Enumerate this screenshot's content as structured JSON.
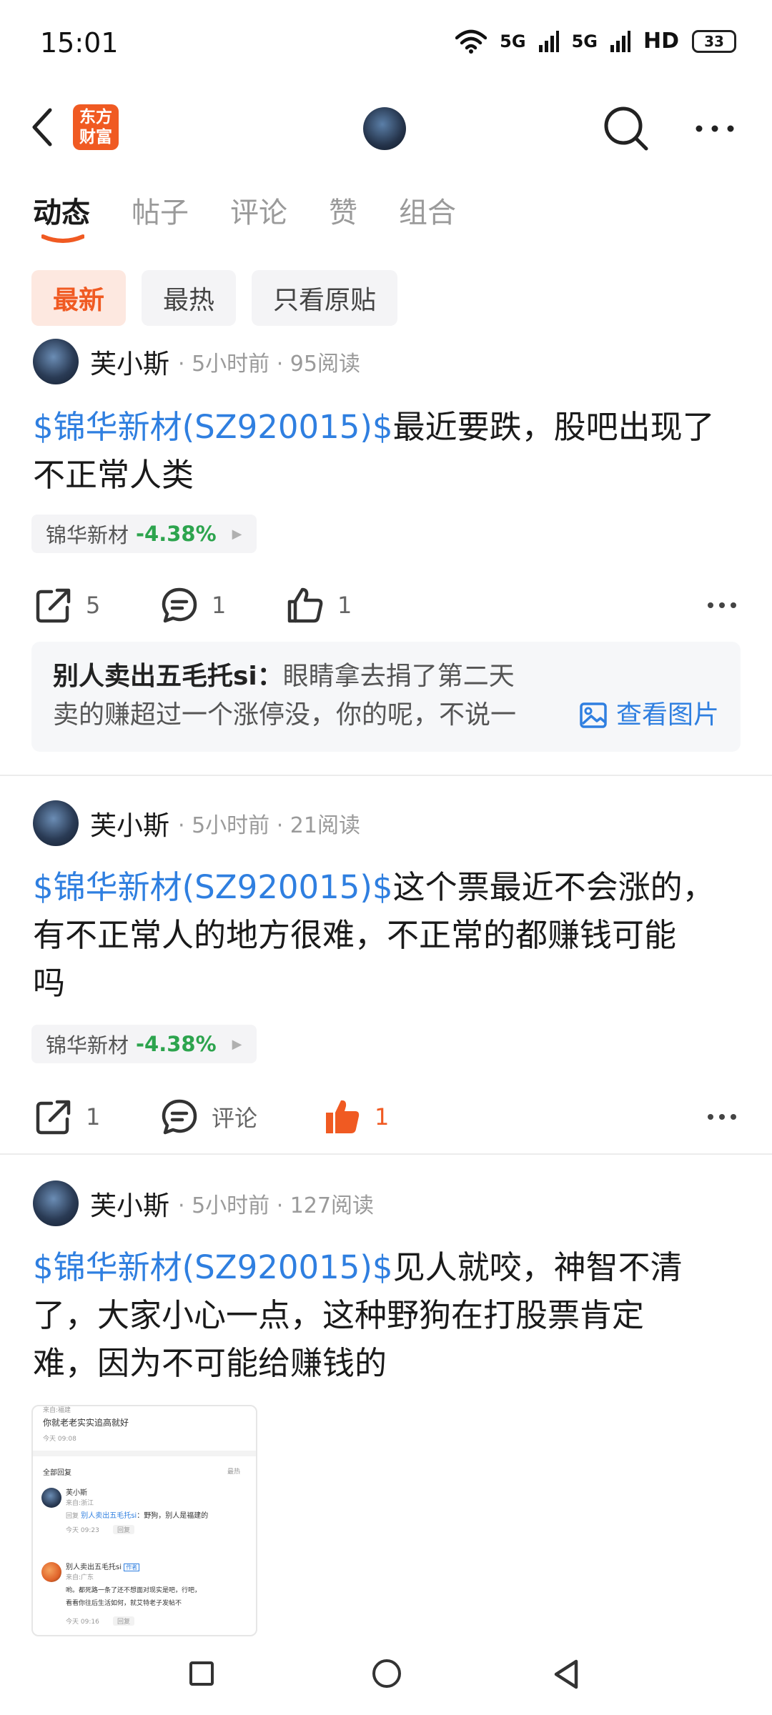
{
  "status_bar": {
    "time": "15:01",
    "signal_labels": [
      "5G",
      "5G",
      "HD"
    ],
    "battery": "33"
  },
  "nav": {
    "logo_text": "东方\n财富",
    "logo_line1": "东方",
    "logo_line2": "财富"
  },
  "tabs": [
    "动态",
    "帖子",
    "评论",
    "赞",
    "组合"
  ],
  "filters": [
    "最新",
    "最热",
    "只看原贴"
  ],
  "colors": {
    "accent": "#f05a22",
    "link": "#2f7fe0",
    "down": "#2da44e"
  },
  "posts": [
    {
      "author": "芙小斯",
      "meta": "· 5小时前 · 95阅读",
      "stock_link": "$锦华新材(SZ920015)$",
      "text_line1": "最近要跌，股吧出现了",
      "text_line2": "不正常人类",
      "stock_name": "锦华新材",
      "stock_change": "-4.38%",
      "shares": "5",
      "comments": "1",
      "likes": "1",
      "reply": {
        "author": "别人卖出五毛托si：",
        "line1": "眼睛拿去捐了第二天",
        "line2": "卖的赚超过一个涨停没，你的呢，不说一",
        "view_image": "查看图片"
      }
    },
    {
      "author": "芙小斯",
      "meta": "· 5小时前 · 21阅读",
      "stock_link": "$锦华新材(SZ920015)$",
      "text_line1": "这个票最近不会涨的，",
      "text_line2": "有不正常人的地方很难，不正常的都赚钱可能",
      "text_line3": "吗",
      "stock_name": "锦华新材",
      "stock_change": "-4.38%",
      "shares": "1",
      "comments": "评论",
      "likes": "1"
    },
    {
      "author": "芙小斯",
      "meta": "· 5小时前 · 127阅读",
      "stock_link": "$锦华新材(SZ920015)$",
      "text_line1": "见人就咬，神智不清",
      "text_line2": "了，大家小心一点，这种野狗在打股票肯定",
      "text_line3": "难，因为不可能给赚钱的",
      "thumbnail": {
        "top_caption": "来自:福建",
        "line1": "你就老老实实追高就好",
        "line1_meta": "今天 09:08",
        "section": "全部回复",
        "sort": "最热",
        "r1_name": "芙小斯",
        "r1_loc": "来自:浙江",
        "r1_prefix": "回复",
        "r1_target": "别人卖出五毛托si",
        "r1_text": "：野狗，别人是福建的",
        "r1_time": "今天 09:23",
        "r1_reply": "回复",
        "r2_name": "别人卖出五毛托si",
        "r2_badge": "作者",
        "r2_loc": "来自:广东",
        "r2_text1": "哟。都死路一条了还不想面对现实是吧，行吧，",
        "r2_text2": "看看你往后生活如何，就艾特老子发帖不",
        "r2_time": "今天 09:16",
        "r2_reply": "回复"
      }
    }
  ]
}
